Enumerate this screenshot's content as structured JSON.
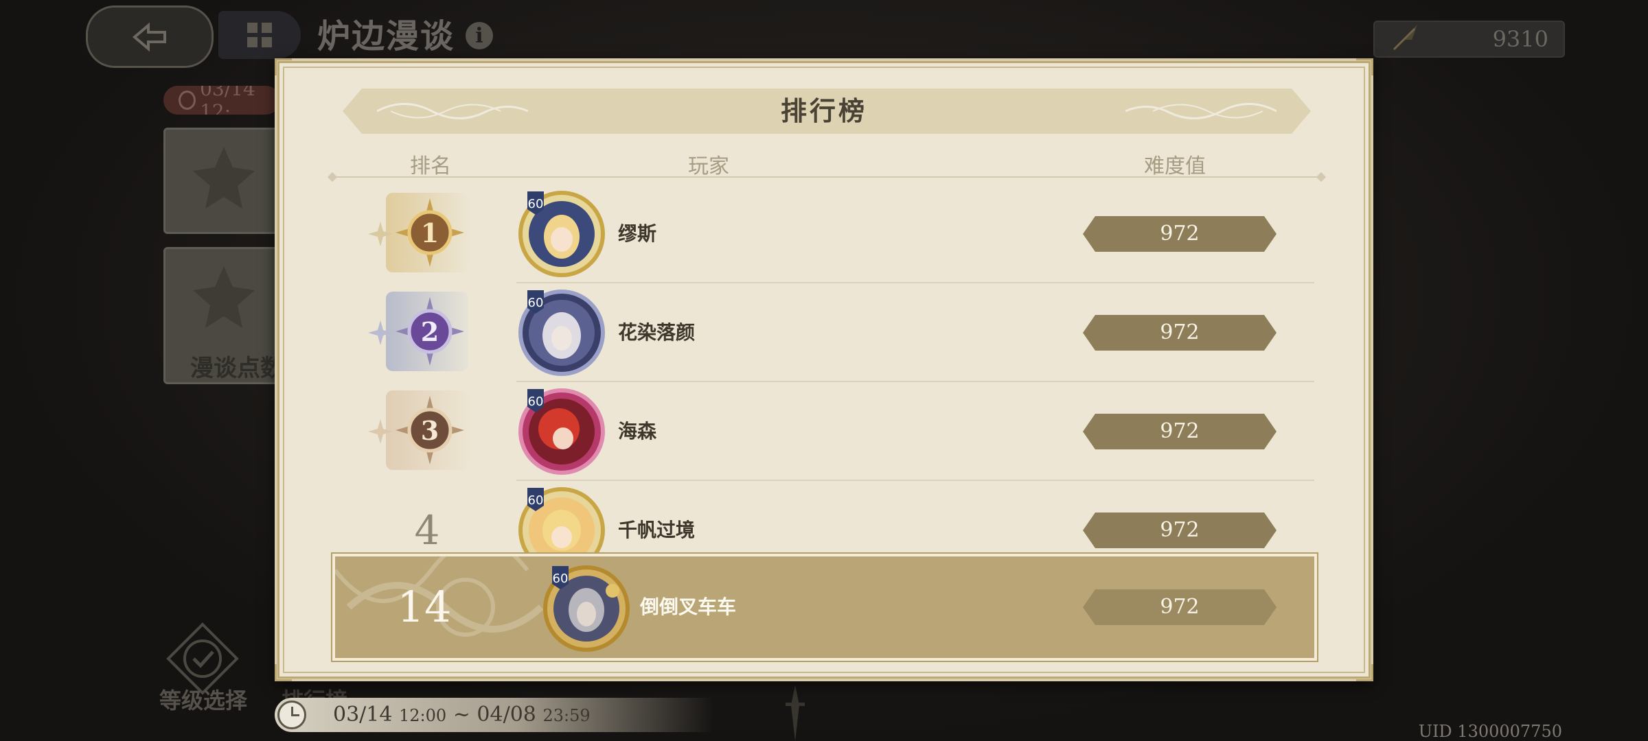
{
  "header": {
    "title": "炉边漫谈",
    "currency_value": "9310",
    "event_date_start": "03/14 12:"
  },
  "sidebar": {
    "card2_label": "漫谈点数",
    "level_select_label": "等级选择",
    "ranking_tab_label": "排行榜"
  },
  "leaderboard": {
    "title": "排行榜",
    "columns": {
      "rank": "排名",
      "player": "玩家",
      "score": "难度值"
    },
    "rows": [
      {
        "rank": "1",
        "level": "60",
        "name": "缪斯",
        "score": "972",
        "medal": "gold"
      },
      {
        "rank": "2",
        "level": "60",
        "name": "花染落颜",
        "score": "972",
        "medal": "silver"
      },
      {
        "rank": "3",
        "level": "60",
        "name": "海森",
        "score": "972",
        "medal": "bronze"
      },
      {
        "rank": "4",
        "level": "60",
        "name": "千帆过境",
        "score": "972",
        "medal": "none"
      }
    ],
    "self": {
      "rank": "14",
      "level": "60",
      "name": "倒倒叉车车",
      "score": "972"
    }
  },
  "period": {
    "start_date": "03/14",
    "start_time": "12:00",
    "separator": "~",
    "end_date": "04/08",
    "end_time": "23:59"
  },
  "footer": {
    "uid": "UID 1300007750"
  },
  "colors": {
    "modal_bg": "#ede6d4",
    "score_pill": "#8e7d59",
    "self_row": "#b9a575",
    "gold": "#c9a04e",
    "silver": "#7a5aa8",
    "bronze": "#8a6650"
  }
}
